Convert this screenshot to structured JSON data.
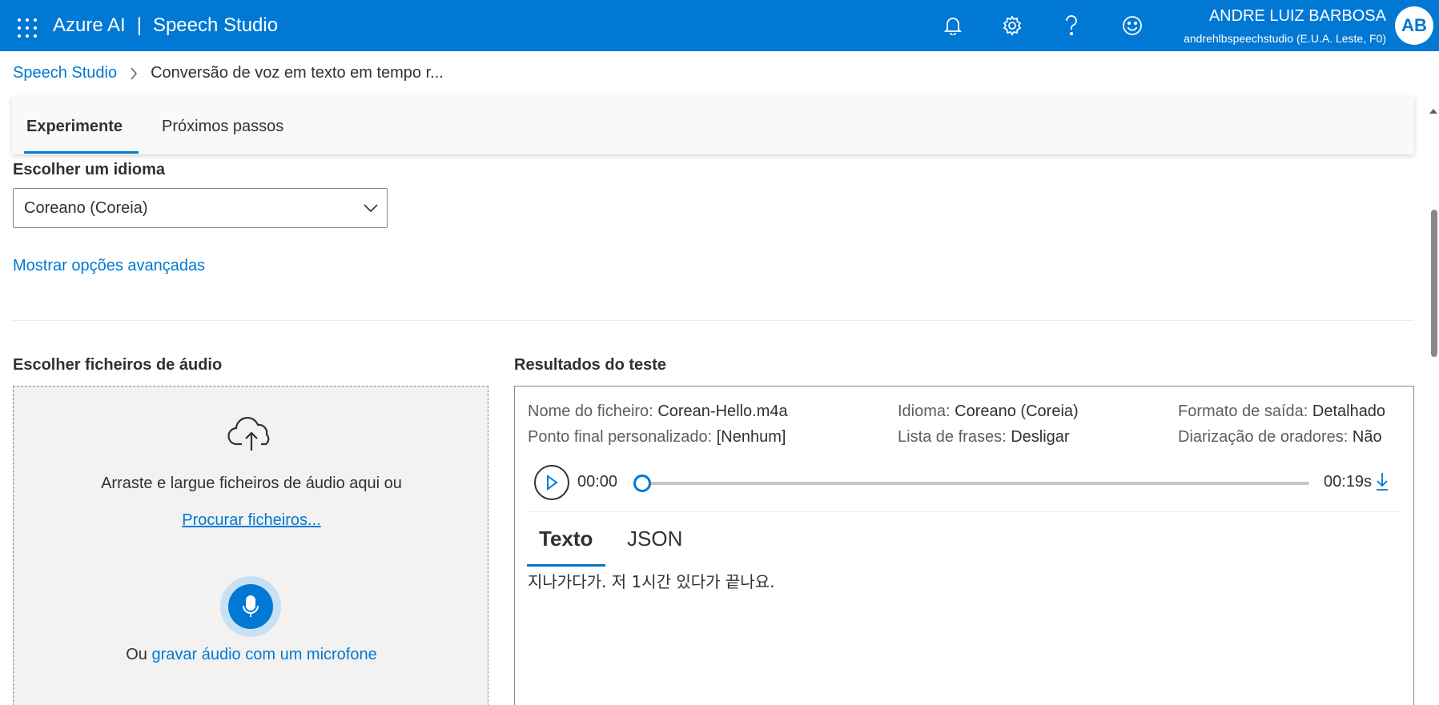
{
  "header": {
    "brand": "Azure AI",
    "separator": "|",
    "product": "Speech Studio",
    "user_name": "ANDRE LUIZ BARBOSA",
    "user_resource": "andrehlbspeechstudio (E.U.A. Leste, F0)",
    "avatar_initials": "AB",
    "icons": [
      "waffle-icon",
      "bell-icon",
      "gear-icon",
      "help-icon",
      "smiley-icon"
    ]
  },
  "breadcrumb": {
    "root": "Speech Studio",
    "current": "Conversão de voz em texto em tempo r..."
  },
  "tabs": [
    {
      "label": "Experimente",
      "active": true
    },
    {
      "label": "Próximos passos",
      "active": false
    }
  ],
  "language": {
    "label": "Escolher um idioma",
    "selected": "Coreano (Coreia)",
    "advanced_link": "Mostrar opções avançadas"
  },
  "upload": {
    "title": "Escolher ficheiros de áudio",
    "drag_text": "Arraste e largue ficheiros de áudio aqui ou",
    "browse_link": "Procurar ficheiros...",
    "or_text": "Ou",
    "mic_link": "gravar áudio com um microfone"
  },
  "results": {
    "title": "Resultados do teste",
    "meta": {
      "file_label": "Nome do ficheiro:",
      "file_value": "Corean-Hello.m4a",
      "language_label": "Idioma:",
      "language_value": "Coreano (Coreia)",
      "format_label": "Formato de saída:",
      "format_value": "Detalhado",
      "endpoint_label": "Ponto final personalizado:",
      "endpoint_value": "[Nenhum]",
      "phrase_label": "Lista de frases:",
      "phrase_value": "Desligar",
      "diarization_label": "Diarização de oradores:",
      "diarization_value": "Não"
    },
    "player": {
      "current_time": "00:00",
      "duration": "00:19s",
      "progress": 0
    },
    "tabs": [
      {
        "label": "Texto",
        "active": true
      },
      {
        "label": "JSON",
        "active": false
      }
    ],
    "transcript": "지나가다가. 저 1시간 있다가 끝나요."
  },
  "colors": {
    "accent": "#0078d4",
    "text": "#323130",
    "muted": "#605e5c",
    "panel": "#f3f2f1"
  }
}
